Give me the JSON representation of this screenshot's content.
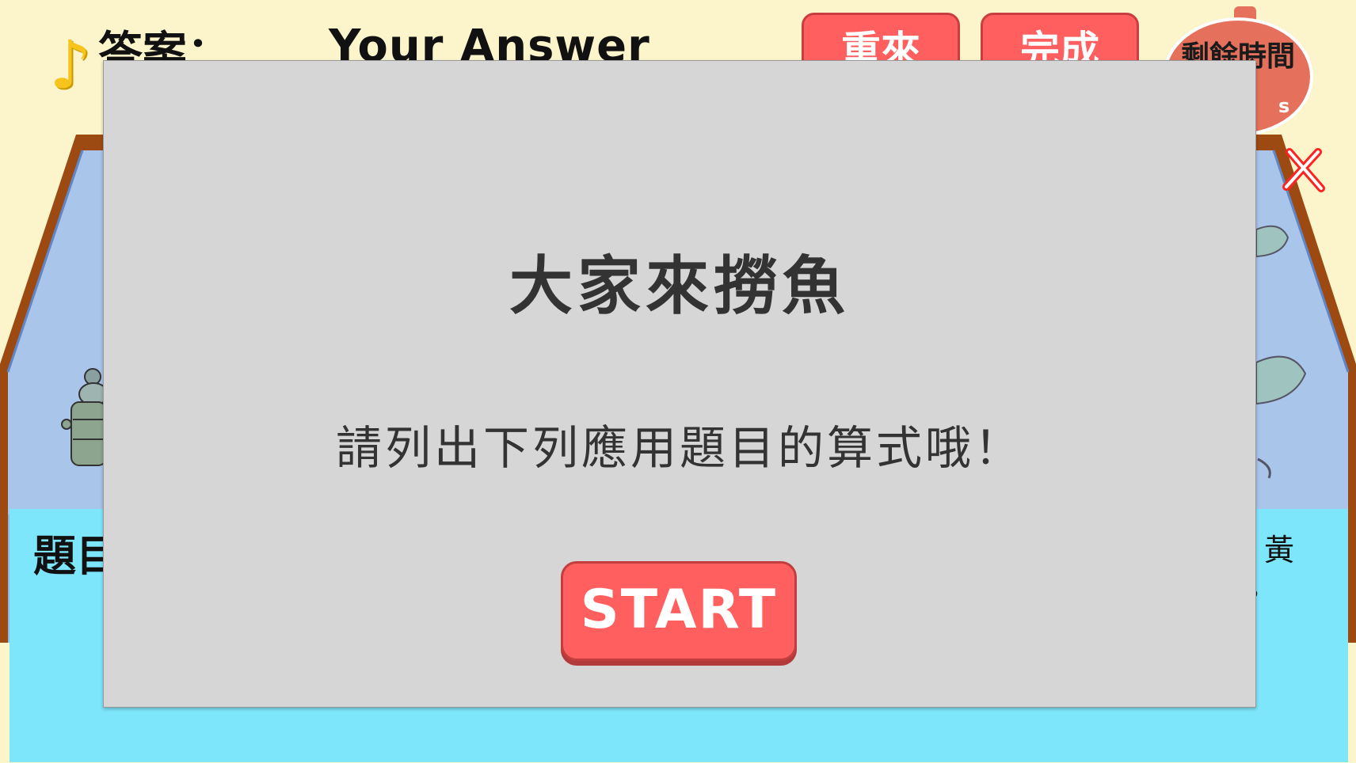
{
  "header": {
    "music_icon": "♪",
    "answer_label": "答案：",
    "answer_value": "Your Answer",
    "reset_label": "重來",
    "done_label": "完成"
  },
  "timer": {
    "label": "剩餘時間",
    "unit": "s"
  },
  "question": {
    "label": "題目",
    "fragment_right": "黃",
    "fragment_right2": "，"
  },
  "dialog": {
    "title": "大家來撈魚",
    "subtitle": "請列出下列應用題目的算式哦！",
    "start_label": "START"
  },
  "colors": {
    "background": "#fcf5cc",
    "button_red": "#ff5f5f",
    "water": "#7ee6fb",
    "tank_wall": "#8fb5e0",
    "tank_frame": "#9c4a12",
    "dialog_bg": "#d6d6d6",
    "timer": "#e5715c"
  },
  "icons": {
    "music": "music-note-icon",
    "wrong_mark": "red-x-icon",
    "fish": "fish-icon",
    "robot": "robot-character-icon"
  }
}
